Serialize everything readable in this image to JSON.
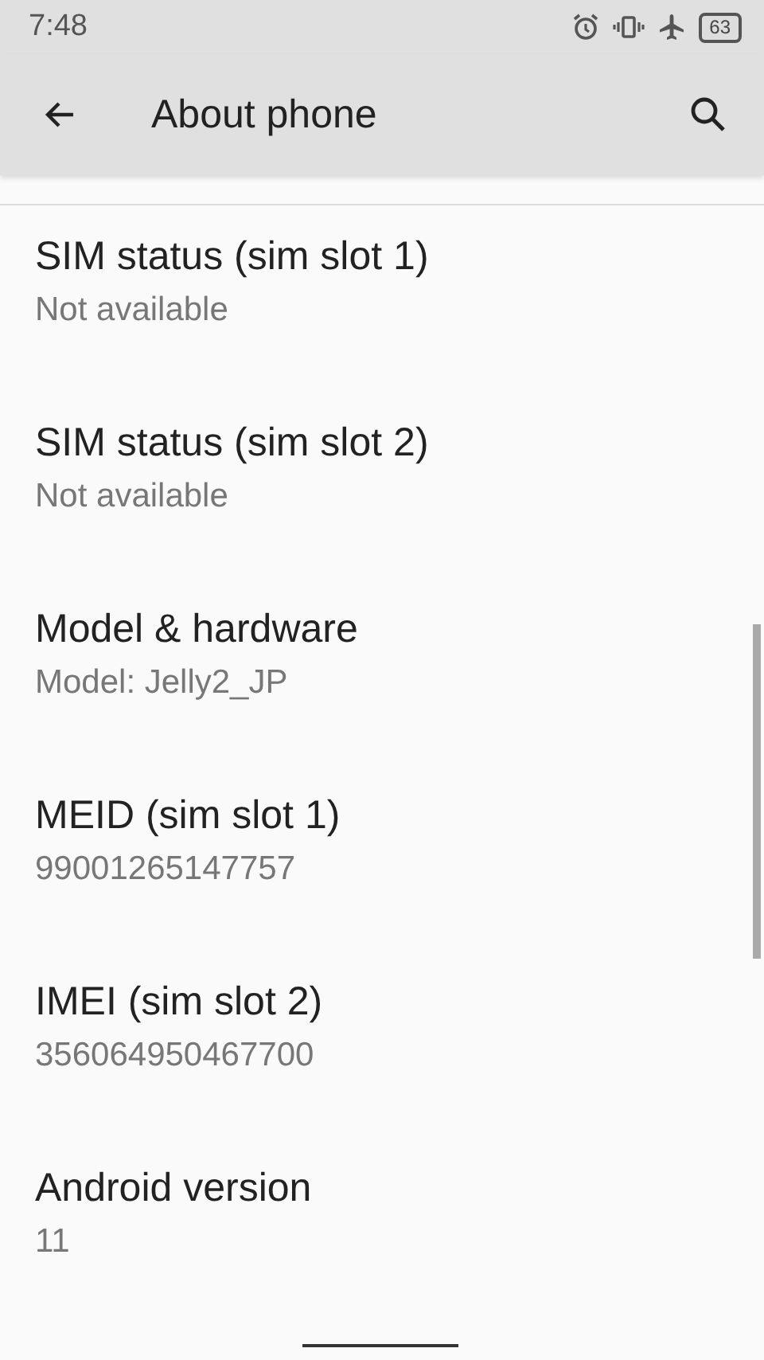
{
  "status_bar": {
    "time": "7:48",
    "battery": "63"
  },
  "toolbar": {
    "title": "About phone"
  },
  "items": [
    {
      "title": "SIM status (sim slot 1)",
      "summary": "Not available"
    },
    {
      "title": "SIM status (sim slot 2)",
      "summary": "Not available"
    },
    {
      "title": "Model & hardware",
      "summary": "Model: Jelly2_JP"
    },
    {
      "title": "MEID (sim slot 1)",
      "summary": "99001265147757"
    },
    {
      "title": "IMEI (sim slot 2)",
      "summary": "356064950467700"
    },
    {
      "title": "Android version",
      "summary": "11"
    }
  ]
}
